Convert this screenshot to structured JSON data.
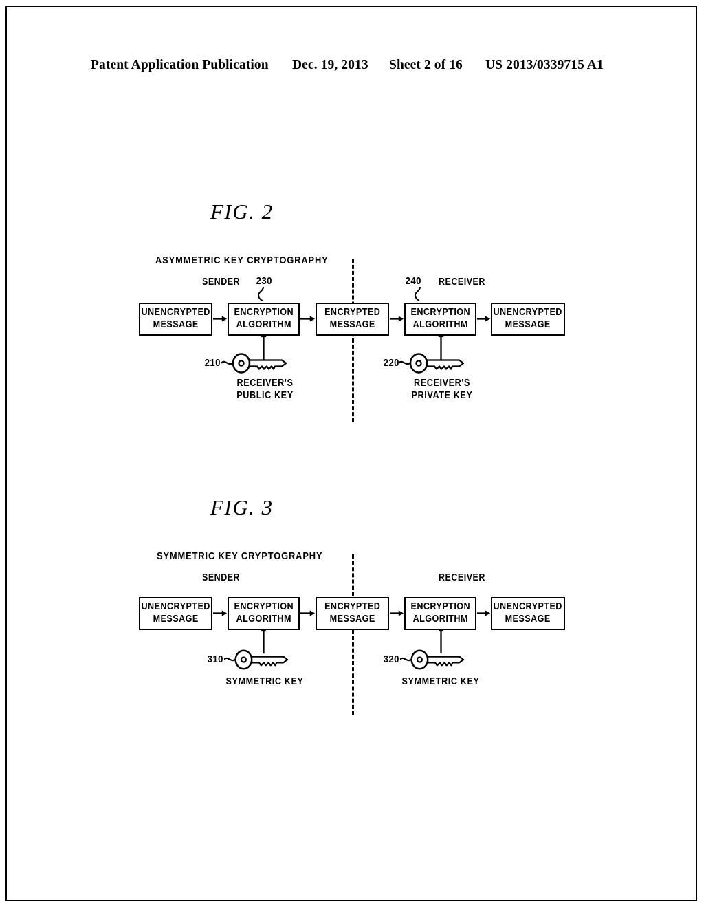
{
  "header": {
    "publication_title": "Patent Application Publication",
    "date": "Dec. 19, 2013",
    "sheet": "Sheet 2 of 16",
    "publication_number": "US 2013/0339715 A1"
  },
  "figures": [
    {
      "caption": "FIG. 2",
      "diagram_title": "ASYMMETRIC KEY CRYPTOGRAPHY",
      "sender_label": "SENDER",
      "receiver_label": "RECEIVER",
      "sender_ref": "230",
      "receiver_ref": "240",
      "boxes": [
        {
          "line1": "UNENCRYPTED",
          "line2": "MESSAGE"
        },
        {
          "line1": "ENCRYPTION",
          "line2": "ALGORITHM"
        },
        {
          "line1": "ENCRYPTED",
          "line2": "MESSAGE"
        },
        {
          "line1": "ENCRYPTION",
          "line2": "ALGORITHM"
        },
        {
          "line1": "UNENCRYPTED",
          "line2": "MESSAGE"
        }
      ],
      "keys": [
        {
          "ref": "210",
          "line1": "RECEIVER'S",
          "line2": "PUBLIC KEY"
        },
        {
          "ref": "220",
          "line1": "RECEIVER'S",
          "line2": "PRIVATE KEY"
        }
      ]
    },
    {
      "caption": "FIG. 3",
      "diagram_title": "SYMMETRIC KEY CRYPTOGRAPHY",
      "sender_label": "SENDER",
      "receiver_label": "RECEIVER",
      "sender_ref": "",
      "receiver_ref": "",
      "boxes": [
        {
          "line1": "UNENCRYPTED",
          "line2": "MESSAGE"
        },
        {
          "line1": "ENCRYPTION",
          "line2": "ALGORITHM"
        },
        {
          "line1": "ENCRYPTED",
          "line2": "MESSAGE"
        },
        {
          "line1": "ENCRYPTION",
          "line2": "ALGORITHM"
        },
        {
          "line1": "UNENCRYPTED",
          "line2": "MESSAGE"
        }
      ],
      "keys": [
        {
          "ref": "310",
          "line1": "SYMMETRIC KEY",
          "line2": ""
        },
        {
          "ref": "320",
          "line1": "SYMMETRIC KEY",
          "line2": ""
        }
      ]
    }
  ],
  "colors": {
    "ink": "#000000",
    "paper": "#ffffff"
  }
}
